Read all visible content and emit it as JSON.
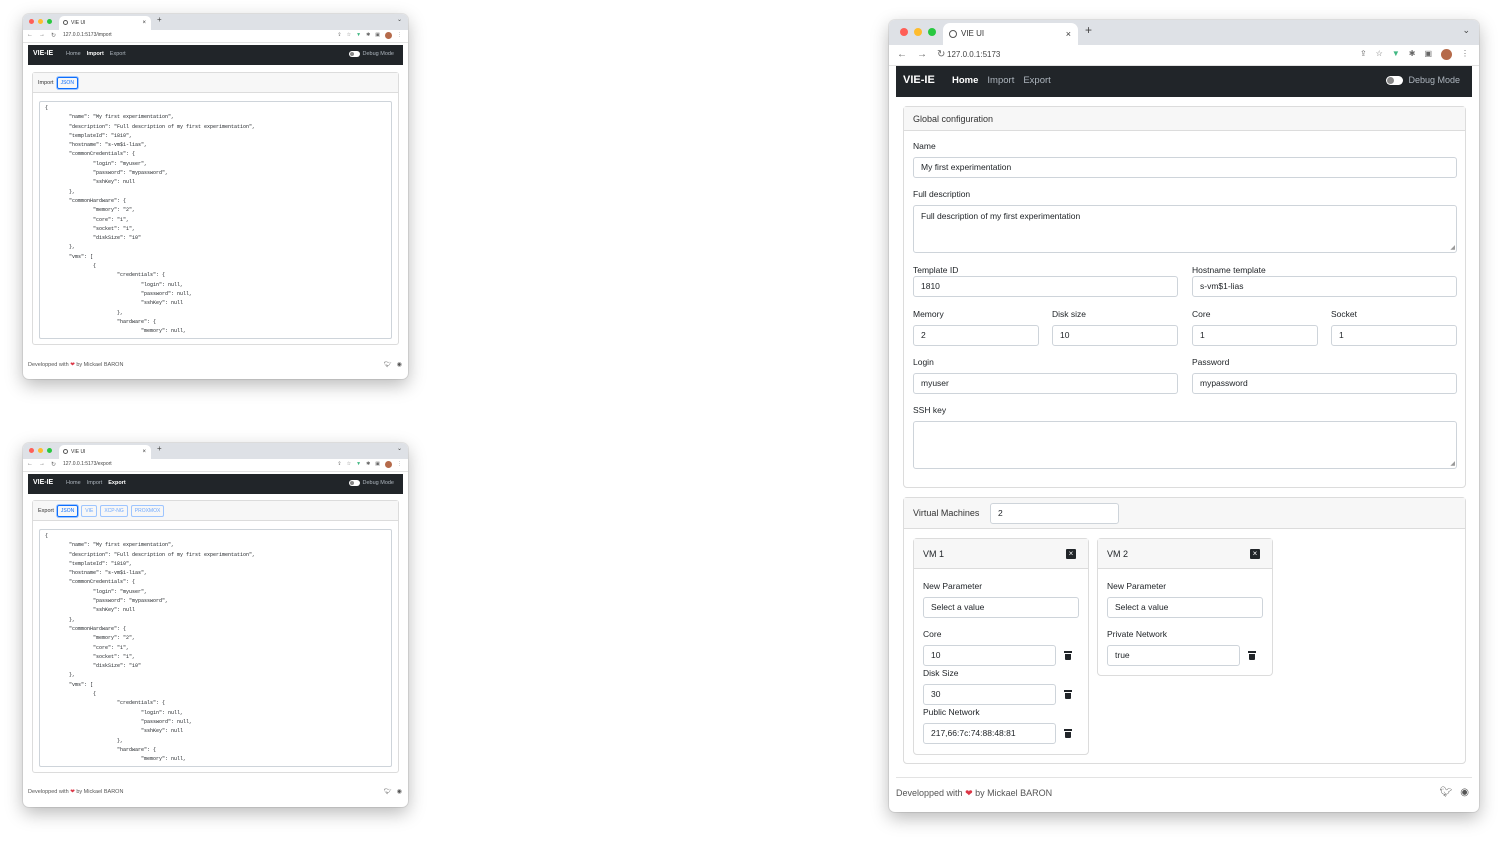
{
  "tab_title": "VIE UI",
  "brand": "VIE-IE",
  "nav": {
    "home": "Home",
    "import": "Import",
    "export": "Export"
  },
  "debug_label": "Debug Mode",
  "footer": {
    "prefix": "Developped with",
    "suffix": "by Mickael BARON"
  },
  "windows": {
    "import": {
      "url": "127.0.0.1:5173/import",
      "card_label": "Import",
      "formats": [
        "JSON"
      ],
      "json_text": "{\n        \"name\": \"My first experimentation\",\n        \"description\": \"Full description of my first experimentation\",\n        \"templateId\": \"1810\",\n        \"hostname\": \"s-vm$1-lias\",\n        \"commonCredentials\": {\n                \"login\": \"myuser\",\n                \"password\": \"mypassword\",\n                \"sshKey\": null\n        },\n        \"commonHardware\": {\n                \"memory\": \"2\",\n                \"core\": \"1\",\n                \"socket\": \"1\",\n                \"diskSize\": \"10\"\n        },\n        \"vms\": [\n                {\n                        \"credentials\": {\n                                \"login\": null,\n                                \"password\": null,\n                                \"sshKey\": null\n                        },\n                        \"hardware\": {\n                                \"memory\": null,"
    },
    "export": {
      "url": "127.0.0.1:5173/export",
      "card_label": "Export",
      "formats": [
        "JSON",
        "VIE",
        "XCP-NG",
        "PROXMOX"
      ],
      "json_text": "{\n        \"name\": \"My first experimentation\",\n        \"description\": \"Full description of my first experimentation\",\n        \"templateId\": \"1810\",\n        \"hostname\": \"s-vm$1-lias\",\n        \"commonCredentials\": {\n                \"login\": \"myuser\",\n                \"password\": \"mypassword\",\n                \"sshKey\": null\n        },\n        \"commonHardware\": {\n                \"memory\": \"2\",\n                \"core\": \"1\",\n                \"socket\": \"1\",\n                \"diskSize\": \"10\"\n        },\n        \"vms\": [\n                {\n                        \"credentials\": {\n                                \"login\": null,\n                                \"password\": null,\n                                \"sshKey\": null\n                        },\n                        \"hardware\": {\n                                \"memory\": null,"
    },
    "home": {
      "url": "127.0.0.1:5173",
      "global_title": "Global configuration",
      "fields": {
        "name_label": "Name",
        "name_value": "My first experimentation",
        "description_label": "Full description",
        "description_value": "Full description of my first experimentation",
        "template_label": "Template ID",
        "template_value": "1810",
        "hostname_label": "Hostname template",
        "hostname_value": "s-vm$1-lias",
        "memory_label": "Memory",
        "memory_value": "2",
        "disk_label": "Disk size",
        "disk_value": "10",
        "core_label": "Core",
        "core_value": "1",
        "socket_label": "Socket",
        "socket_value": "1",
        "login_label": "Login",
        "login_value": "myuser",
        "password_label": "Password",
        "password_value": "mypassword",
        "ssh_label": "SSH key",
        "ssh_value": ""
      },
      "vm_count_label": "Virtual Machines",
      "vm_count_value": "2",
      "vms": [
        {
          "title": "VM 1",
          "new_param_label": "New Parameter",
          "select_placeholder": "Select a value",
          "params": [
            {
              "label": "Core",
              "value": "10"
            },
            {
              "label": "Disk Size",
              "value": "30"
            },
            {
              "label": "Public Network",
              "value": "217,66:7c:74:88:48:81"
            }
          ]
        },
        {
          "title": "VM 2",
          "new_param_label": "New Parameter",
          "select_placeholder": "Select a value",
          "params": [
            {
              "label": "Private Network",
              "value": "true"
            }
          ]
        }
      ]
    }
  },
  "icons": {
    "twitter": "twitter-icon",
    "github": "github-icon",
    "close": "close-icon",
    "trash": "trash-icon"
  },
  "colors": {
    "navbar": "#212529",
    "accent": "#0d6efd",
    "heart": "#dc3545"
  }
}
